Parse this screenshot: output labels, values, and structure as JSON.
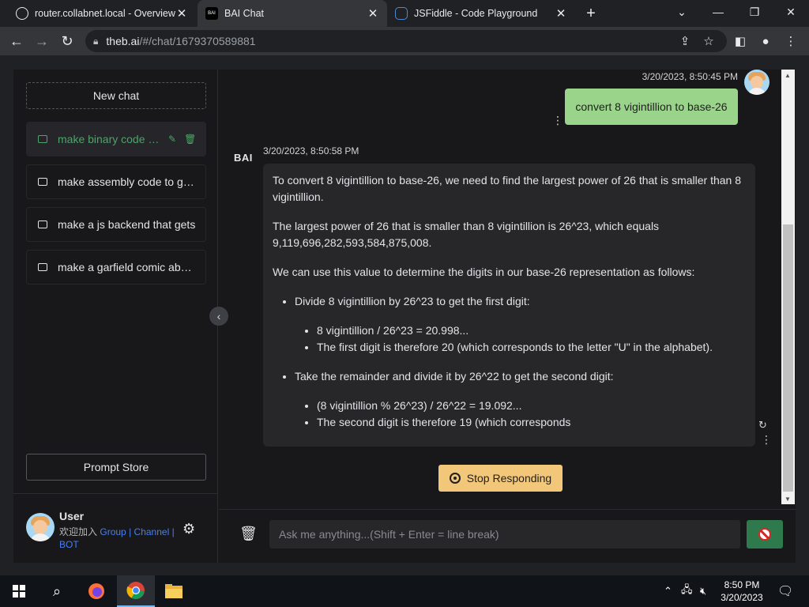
{
  "browser": {
    "tabs": [
      {
        "title": "router.collabnet.local - Overview",
        "active": false
      },
      {
        "title": "BAI Chat",
        "active": true
      },
      {
        "title": "JSFiddle - Code Playground",
        "active": false
      }
    ],
    "url_host": "theb.ai",
    "url_path": "/#/chat/1679370589881"
  },
  "sidebar": {
    "new_chat_label": "New chat",
    "conversations": [
      {
        "title": "make binary code that makes a coin flip",
        "active": true
      },
      {
        "title": "make assembly code to generate",
        "active": false
      },
      {
        "title": "make a js backend that gets",
        "active": false
      },
      {
        "title": "make a garfield comic about",
        "active": false
      }
    ],
    "prompt_store_label": "Prompt Store",
    "user": {
      "name": "User",
      "join_text": "欢迎加入",
      "link_group": "Group",
      "sep1": "|",
      "link_channel": "Channel",
      "sep2": "|",
      "link_bot": "BOT"
    }
  },
  "chat": {
    "user_message": {
      "timestamp": "3/20/2023, 8:50:45 PM",
      "text": "convert 8 vigintillion to base-26"
    },
    "bot_logo": "BAI",
    "bot_message": {
      "timestamp": "3/20/2023, 8:50:58 PM",
      "p1": "To convert 8 vigintillion to base-26, we need to find the largest power of 26 that is smaller than 8 vigintillion.",
      "p2": "The largest power of 26 that is smaller than 8 vigintillion is 26^23, which equals 9,119,696,282,593,584,875,008.",
      "p3": "We can use this value to determine the digits in our base-26 representation as follows:",
      "bullet1": "Divide 8 vigintillion by 26^23 to get the first digit:",
      "bullet1_sub1": "8 vigintillion / 26^23 = 20.998...",
      "bullet1_sub2": "The first digit is therefore 20 (which corresponds to the letter \"U\" in the alphabet).",
      "bullet2": "Take the remainder and divide it by 26^22 to get the second digit:",
      "bullet2_sub1": "(8 vigintillion % 26^23) / 26^22 = 19.092...",
      "bullet2_sub2": "The second digit is therefore 19 (which corresponds"
    },
    "stop_label": "Stop Responding",
    "input_placeholder": "Ask me anything...(Shift + Enter = line break)"
  },
  "taskbar": {
    "time": "8:50 PM",
    "date": "3/20/2023"
  },
  "colors": {
    "user_bubble": "#9ad48a",
    "active_convo": "#4fa36b",
    "stop_button": "#f3c77a",
    "send_button": "#2f7a4c"
  }
}
